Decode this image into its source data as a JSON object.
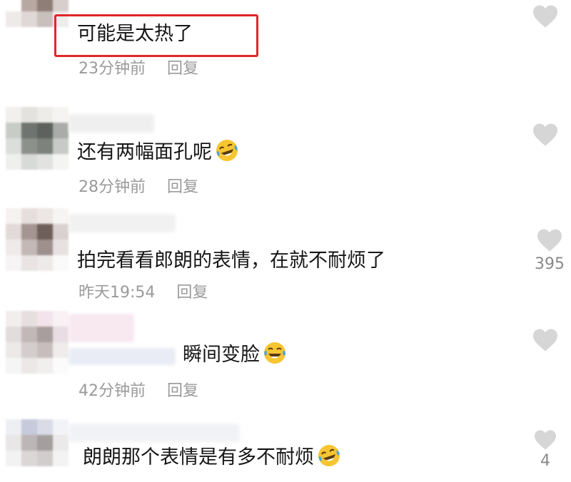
{
  "comments": [
    {
      "text": "可能是太热了",
      "time": "23分钟前",
      "reply_label": "回复",
      "like_count": "",
      "emoji": "",
      "highlighted": true
    },
    {
      "text": "还有两幅面孔呢",
      "time": "28分钟前",
      "reply_label": "回复",
      "like_count": "",
      "emoji": "laugh-cry-emoji"
    },
    {
      "text": "拍完看看郎朗的表情，在就不耐烦了",
      "time": "昨天19:54",
      "reply_label": "回复",
      "like_count": "395",
      "emoji": ""
    },
    {
      "text": "瞬间变脸",
      "time": "42分钟前",
      "reply_label": "回复",
      "like_count": "",
      "emoji": "laugh-cry-emoji"
    },
    {
      "text": "朗朗那个表情是有多不耐烦",
      "time": "",
      "reply_label": "",
      "like_count": "4",
      "emoji": "laugh-cry-emoji"
    }
  ],
  "colors": {
    "highlight_border": "#e0262a",
    "meta_text": "#9a9a9a",
    "heart_icon": "#d6d6d6"
  },
  "icons": {
    "like": "heart-icon",
    "emoji": "laugh-cry-emoji"
  }
}
